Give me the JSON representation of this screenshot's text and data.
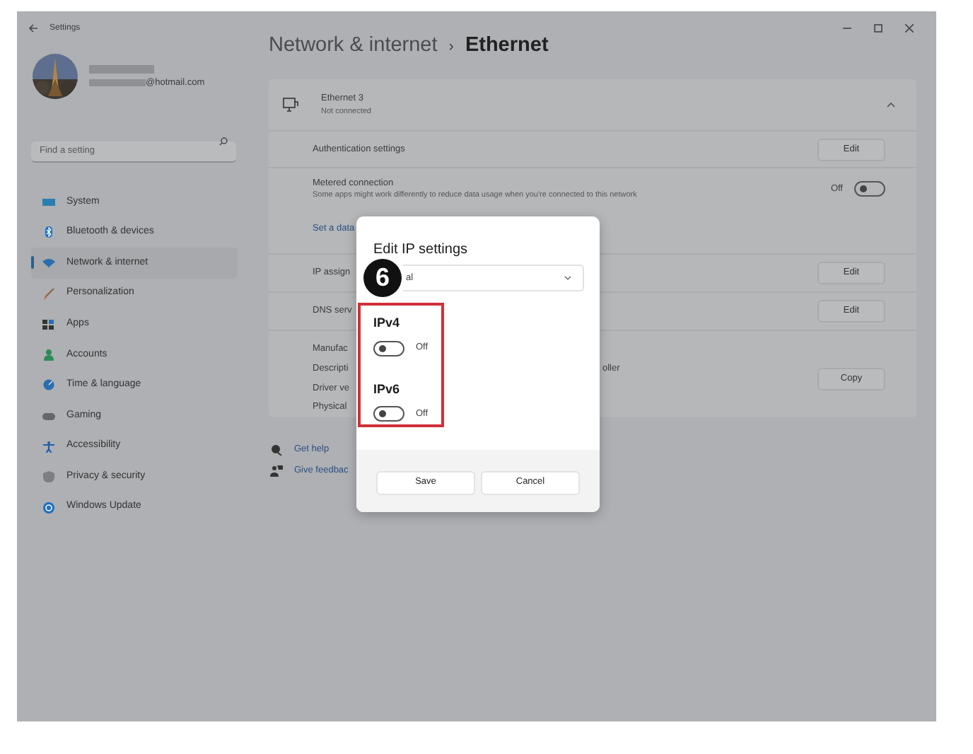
{
  "window": {
    "title": "Settings"
  },
  "account": {
    "email": "@hotmail.com"
  },
  "search": {
    "placeholder": "Find a setting"
  },
  "nav": [
    {
      "label": "System",
      "selected": false
    },
    {
      "label": "Bluetooth & devices",
      "selected": false
    },
    {
      "label": "Network & internet",
      "selected": true
    },
    {
      "label": "Personalization",
      "selected": false
    },
    {
      "label": "Apps",
      "selected": false
    },
    {
      "label": "Accounts",
      "selected": false
    },
    {
      "label": "Time & language",
      "selected": false
    },
    {
      "label": "Gaming",
      "selected": false
    },
    {
      "label": "Accessibility",
      "selected": false
    },
    {
      "label": "Privacy & security",
      "selected": false
    },
    {
      "label": "Windows Update",
      "selected": false
    }
  ],
  "breadcrumb": {
    "parent": "Network & internet",
    "separator": "›",
    "current": "Ethernet"
  },
  "adapter": {
    "name": "Ethernet 3",
    "status": "Not connected",
    "expanded": true,
    "rows": [
      {
        "kind": "button",
        "label": "Authentication settings",
        "button": "Edit"
      },
      {
        "kind": "toggle",
        "label": "Metered connection",
        "description": "Some apps might work differently to reduce data usage when you're connected to this network",
        "state_label": "Off",
        "on": false
      },
      {
        "kind": "link",
        "label": "Set a data"
      },
      {
        "kind": "button",
        "label": "IP assign",
        "button": "Edit"
      },
      {
        "kind": "button",
        "label": "DNS serv",
        "button": "Edit"
      },
      {
        "kind": "details",
        "lines": [
          {
            "label": "Manufac"
          },
          {
            "label": "Descripti",
            "value": "oller"
          },
          {
            "label": "Driver ve"
          },
          {
            "label": "Physical"
          }
        ],
        "button": "Copy"
      }
    ]
  },
  "help_links": [
    {
      "label": "Get help"
    },
    {
      "label": "Give feedbac"
    }
  ],
  "dialog": {
    "title": "Edit IP settings",
    "dropdown": "al",
    "sections": [
      {
        "title": "IPv4",
        "on": false,
        "state_label": "Off"
      },
      {
        "title": "IPv6",
        "on": false,
        "state_label": "Off"
      }
    ],
    "buttons": [
      "Save",
      "Cancel"
    ]
  },
  "annotation": {
    "step": "6"
  }
}
